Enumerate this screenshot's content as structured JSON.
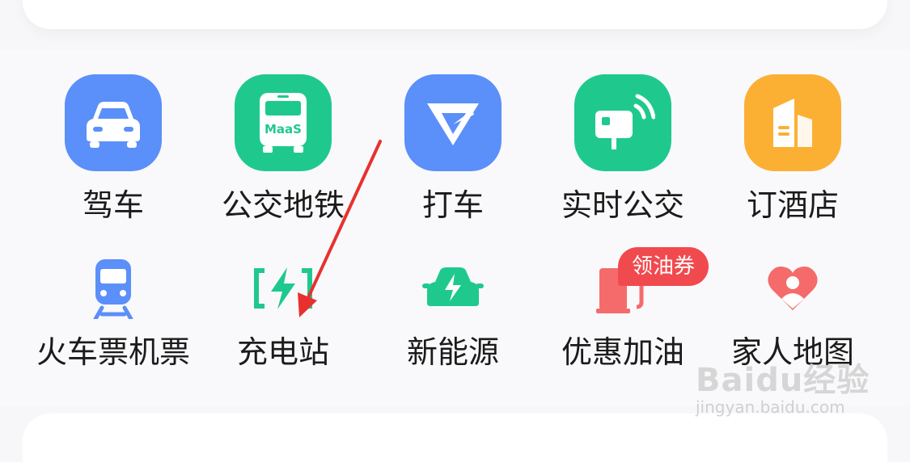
{
  "services": {
    "row1": [
      {
        "label": "驾车",
        "icon": "car-icon",
        "color": "#5b8ff9"
      },
      {
        "label": "公交地铁",
        "icon": "bus-icon",
        "icon_text": "MaaS",
        "color": "#1fc98e"
      },
      {
        "label": "打车",
        "icon": "taxi-icon",
        "color": "#5b8ff9"
      },
      {
        "label": "实时公交",
        "icon": "realtime-bus-icon",
        "color": "#1fc98e"
      },
      {
        "label": "订酒店",
        "icon": "hotel-icon",
        "color": "#fbb034"
      }
    ],
    "row2": [
      {
        "label": "火车票机票",
        "icon": "train-icon",
        "color": "#5b8ff9"
      },
      {
        "label": "充电站",
        "icon": "charging-station-icon",
        "color": "#1fc98e"
      },
      {
        "label": "新能源",
        "icon": "ev-car-icon",
        "color": "#1fc98e"
      },
      {
        "label": "优惠加油",
        "icon": "fuel-pump-icon",
        "badge": "领油券",
        "color": "#f56b6b"
      },
      {
        "label": "家人地图",
        "icon": "family-heart-icon",
        "color": "#f56b6b"
      }
    ]
  },
  "annotation": {
    "arrow_color": "#e8312f"
  },
  "watermark": {
    "logo": "Baidu经验",
    "sub": "jingyan.baidu.com"
  }
}
